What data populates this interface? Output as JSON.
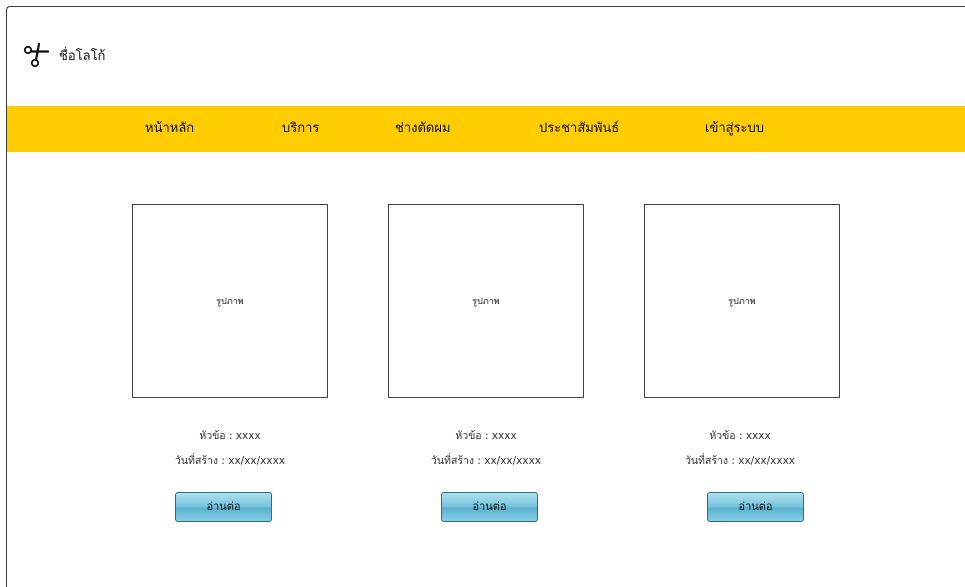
{
  "header": {
    "logo_text": "ชื่อโลโก้",
    "logo_icon": "scissors-icon"
  },
  "nav": {
    "bg_color": "#ffcc00",
    "items": [
      {
        "label": "หน้าหลัก"
      },
      {
        "label": "บริการ"
      },
      {
        "label": "ช่างตัดผม"
      },
      {
        "label": "ประชาสัมพันธ์"
      },
      {
        "label": "เข้าสู่ระบบ"
      }
    ]
  },
  "cards": [
    {
      "image_label": "รูปภาพ",
      "title": "หัวข้อ : xxxx",
      "date": "วันที่สร้าง : xx/xx/xxxx",
      "button_label": "อ่านต่อ"
    },
    {
      "image_label": "รูปภาพ",
      "title": "หัวข้อ : xxxx",
      "date": "วันที่สร้าง : xx/xx/xxxx",
      "button_label": "อ่านต่อ"
    },
    {
      "image_label": "รูปภาพ",
      "title": "หัวข้อ : xxxx",
      "date": "วันที่สร้าง : xx/xx/xxxx",
      "button_label": "อ่านต่อ"
    }
  ]
}
